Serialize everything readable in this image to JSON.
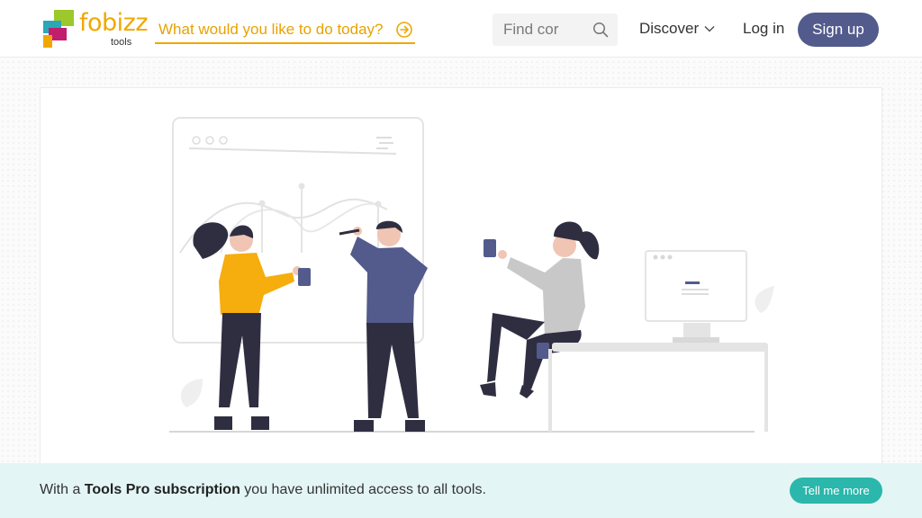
{
  "header": {
    "logo_word": "fobizz",
    "logo_sub": "tools",
    "wish_prompt": "What would you like to do today?",
    "search_placeholder": "Find cor",
    "nav_discover": "Discover",
    "nav_login": "Log in",
    "signup_label": "Sign up"
  },
  "icons": {
    "wish": "arrow-circle-right-icon",
    "search": "search-icon",
    "discover": "chevron-down-icon"
  },
  "banner": {
    "text_before": "With a",
    "text_bold": "Tools Pro subscription",
    "text_after": "you have unlimited access to all tools.",
    "cta_label": "Tell me more"
  },
  "colors": {
    "brand_yellow": "#f0a800",
    "brand_purple": "#525b8c",
    "banner_bg": "#e3f6f5",
    "cta_teal": "#2bb7ab"
  }
}
